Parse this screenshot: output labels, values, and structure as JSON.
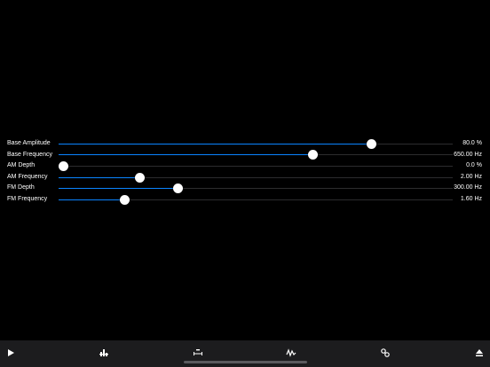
{
  "parameters": [
    {
      "label": "Base Amplitude",
      "value": "80.0 %",
      "level": 0.793
    },
    {
      "label": "Base Frequency",
      "value": "650.00 Hz",
      "level": 0.646
    },
    {
      "label": "AM Depth",
      "value": "0.0 %",
      "level": 0.0
    },
    {
      "label": "AM Frequency",
      "value": "2.00 Hz",
      "level": 0.207
    },
    {
      "label": "FM Depth",
      "value": "300.00 Hz",
      "level": 0.304
    },
    {
      "label": "FM Frequency",
      "value": "1.60 Hz",
      "level": 0.167
    }
  ],
  "toolbar": {
    "items": [
      {
        "name": "play-button",
        "icon": "play-icon"
      },
      {
        "name": "mixer-button",
        "icon": "sliders-icon"
      },
      {
        "name": "tempo-button",
        "icon": "tempo-icon"
      },
      {
        "name": "waveform-button",
        "icon": "waveform-icon"
      },
      {
        "name": "connections-button",
        "icon": "link-icon"
      },
      {
        "name": "eject-button",
        "icon": "eject-icon"
      }
    ]
  },
  "colors": {
    "background": "#000000",
    "accent": "#0a84ff",
    "track": "#2c2c2e",
    "toolbar": "#1c1c1e",
    "text": "#ffffff"
  }
}
